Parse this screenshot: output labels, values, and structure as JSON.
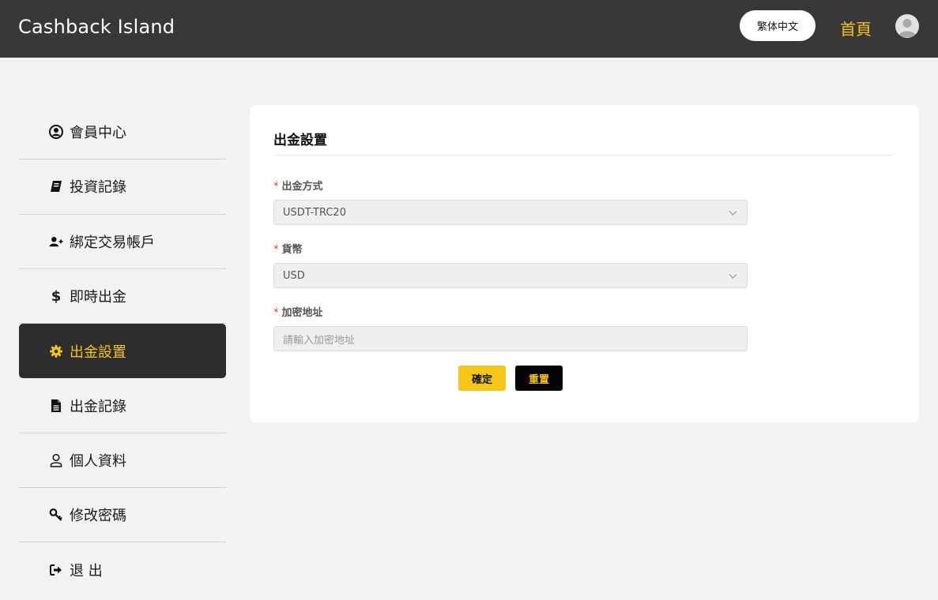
{
  "header": {
    "brand": "Cashback Island",
    "language": "繁体中文",
    "home": "首頁"
  },
  "sidebar": {
    "items": [
      {
        "label": "會員中心",
        "icon": "user-circle-icon"
      },
      {
        "label": "投資記錄",
        "icon": "book-icon"
      },
      {
        "label": "綁定交易帳戶",
        "icon": "user-plus-icon"
      },
      {
        "label": "即時出金",
        "icon": "dollar-icon"
      },
      {
        "label": "出金設置",
        "icon": "gear-icon",
        "active": true
      },
      {
        "label": "出金記錄",
        "icon": "file-icon"
      },
      {
        "label": "個人資料",
        "icon": "user-outline-icon"
      },
      {
        "label": "修改密碼",
        "icon": "key-icon"
      },
      {
        "label": "退 出",
        "icon": "sign-out-icon"
      }
    ]
  },
  "form": {
    "title": "出金設置",
    "fields": [
      {
        "label": "出金方式",
        "required_mark": "*",
        "value": "USDT-TRC20"
      },
      {
        "label": "貨幣",
        "required_mark": "*",
        "value": "USD"
      },
      {
        "label": "加密地址",
        "required_mark": "*",
        "placeholder": "請輸入加密地址"
      }
    ],
    "confirm_label": "確定",
    "reset_label": "重置"
  },
  "colors": {
    "header_bg": "#383838",
    "accent": "#f5c518",
    "active_bg": "#2d2d2d",
    "page_bg": "#f2f2f2"
  }
}
